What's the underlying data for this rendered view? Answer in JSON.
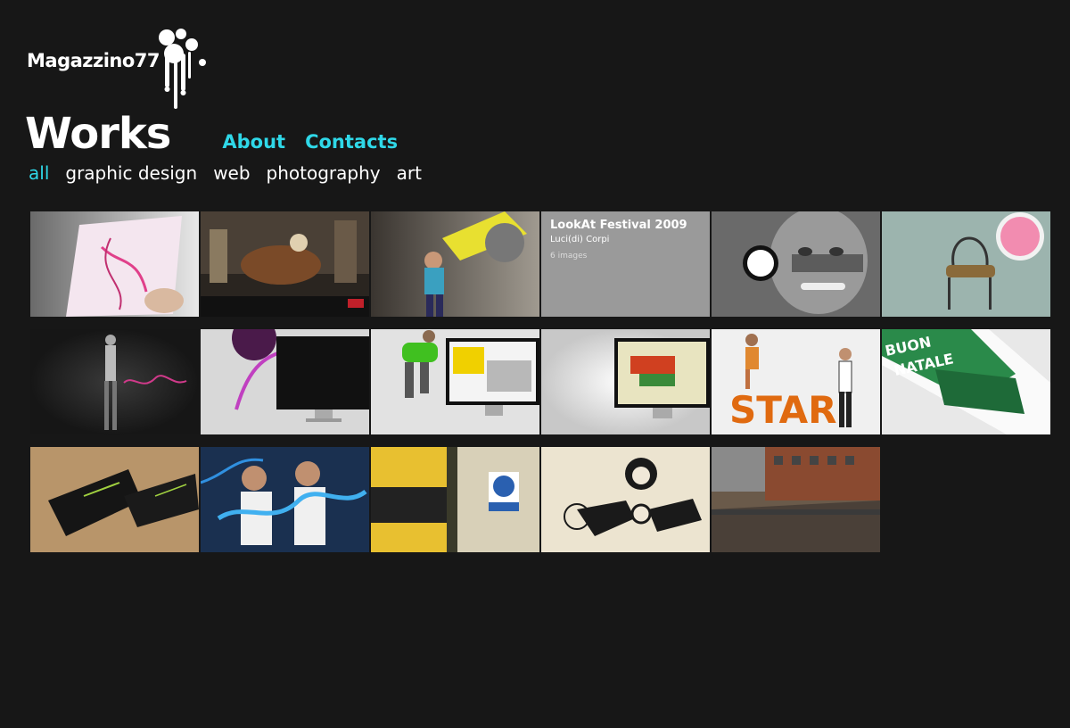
{
  "brand": {
    "logo_text": "Magazzino77"
  },
  "nav": {
    "works": "Works",
    "about": "About",
    "contacts": "Contacts"
  },
  "filters": [
    "all",
    "graphic design",
    "web",
    "photography",
    "art"
  ],
  "active_filter": "all",
  "colors": {
    "accent": "#2fd8e8",
    "background": "#171717",
    "text": "#ffffff"
  },
  "gallery": {
    "hover_item": {
      "title": "LookAt Festival 2009",
      "subtitle": "Luci(di) Corpi",
      "count": "6 images"
    }
  }
}
